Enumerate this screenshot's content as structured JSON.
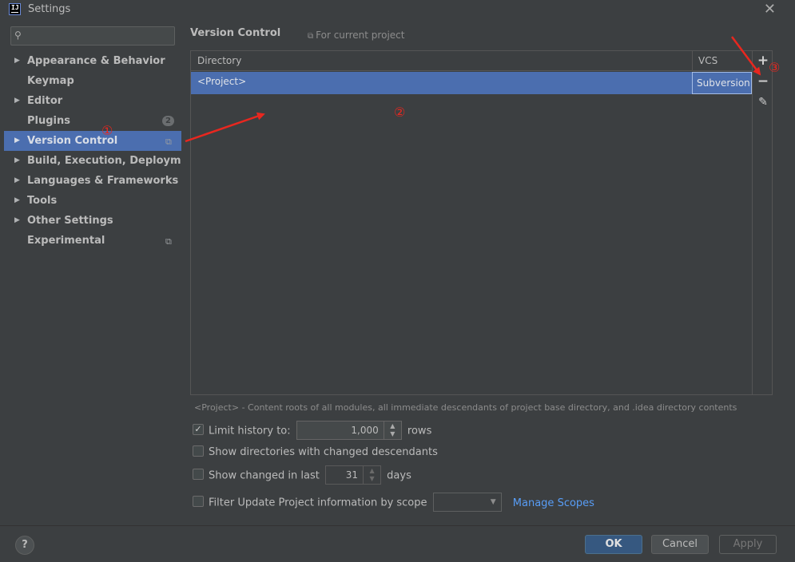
{
  "window": {
    "title": "Settings",
    "logo_text": "IJ",
    "close_glyph": "✕"
  },
  "sidebar": {
    "search": {
      "value": "",
      "placeholder": ""
    },
    "items": [
      {
        "label": "Appearance & Behavior",
        "expandable": true
      },
      {
        "label": "Keymap",
        "expandable": false
      },
      {
        "label": "Editor",
        "expandable": true
      },
      {
        "label": "Plugins",
        "expandable": false,
        "badge": "2"
      },
      {
        "label": "Version Control",
        "expandable": true,
        "selected": true,
        "project_icon": true
      },
      {
        "label": "Build, Execution, Deployment",
        "expandable": true
      },
      {
        "label": "Languages & Frameworks",
        "expandable": true
      },
      {
        "label": "Tools",
        "expandable": true
      },
      {
        "label": "Other Settings",
        "expandable": true
      },
      {
        "label": "Experimental",
        "expandable": false,
        "project_icon": true
      }
    ]
  },
  "main": {
    "title": "Version Control",
    "for_project": "For current project",
    "table": {
      "columns": [
        "Directory",
        "VCS"
      ],
      "rows": [
        {
          "directory": "<Project>",
          "vcs": "Subversion"
        }
      ],
      "toolbar": {
        "add": "+",
        "remove": "−",
        "edit": "✎"
      }
    },
    "description": "<Project> - Content roots of all modules, all immediate descendants of project base directory, and .idea directory contents",
    "options": {
      "limit_history": {
        "label": "Limit history to:",
        "checked": true,
        "value": "1,000",
        "suffix": "rows"
      },
      "show_dirs": {
        "label": "Show directories with changed descendants",
        "checked": false
      },
      "show_changed": {
        "label": "Show changed in last",
        "checked": false,
        "value": "31",
        "suffix": "days"
      },
      "filter_update": {
        "label": "Filter Update Project information by scope",
        "checked": false,
        "scope_value": ""
      },
      "manage_scopes": "Manage Scopes"
    }
  },
  "footer": {
    "help": "?",
    "ok": "OK",
    "cancel": "Cancel",
    "apply": "Apply"
  },
  "annotations": {
    "marker_1": "①",
    "marker_2": "②",
    "marker_3": "③",
    "color": "#e8271f"
  },
  "colors": {
    "background": "#3c3f41",
    "selection": "#4b6eaf",
    "link": "#589df6",
    "ok_button": "#365880"
  }
}
